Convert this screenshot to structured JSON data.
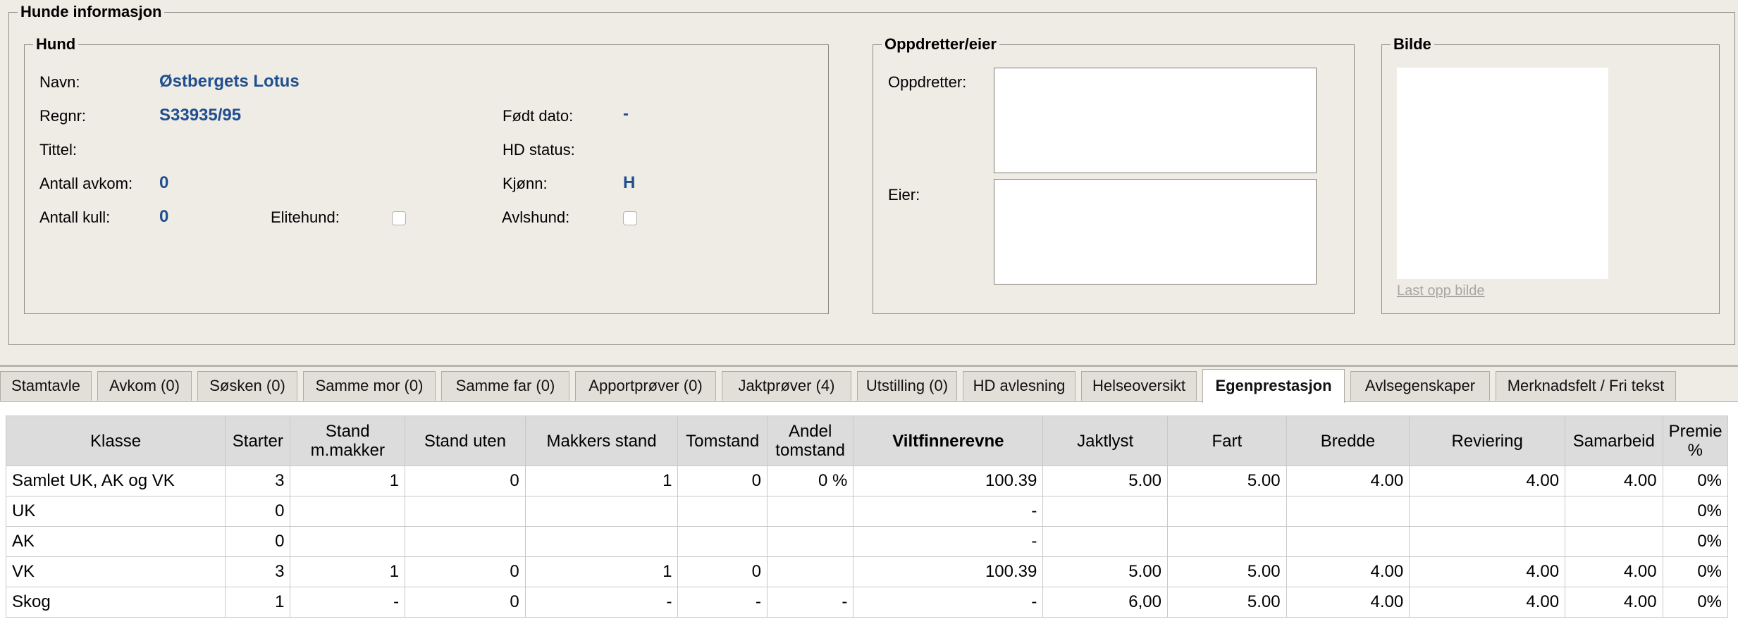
{
  "main_legend": "Hunde informasjon",
  "hund": {
    "legend": "Hund",
    "navn_label": "Navn:",
    "navn_value": "Østbergets Lotus",
    "regnr_label": "Regnr:",
    "regnr_value": "S33935/95",
    "fodt_label": "Født dato:",
    "fodt_value": "-",
    "tittel_label": "Tittel:",
    "hd_label": "HD status:",
    "avkom_label": "Antall avkom:",
    "avkom_value": "0",
    "kjonn_label": "Kjønn:",
    "kjonn_value": "H",
    "kull_label": "Antall kull:",
    "kull_value": "0",
    "elitehund_label": "Elitehund:",
    "avlshund_label": "Avlshund:"
  },
  "oppdretter": {
    "legend": "Oppdretter/eier",
    "oppdretter_label": "Oppdretter:",
    "eier_label": "Eier:"
  },
  "bilde": {
    "legend": "Bilde",
    "upload_link": "Last opp bilde"
  },
  "tabs": [
    "Stamtavle",
    "Avkom (0)",
    "Søsken (0)",
    "Samme mor (0)",
    "Samme far (0)",
    "Apportprøver (0)",
    "Jaktprøver (4)",
    "Utstilling (0)",
    "HD avlesning",
    "Helseoversikt",
    "Egenprestasjon",
    "Avlsegenskaper",
    "Merknadsfelt / Fri tekst"
  ],
  "active_tab": "Egenprestasjon",
  "table": {
    "headers": [
      "Klasse",
      "Starter",
      "Stand m.makker",
      "Stand uten",
      "Makkers stand",
      "Tomstand",
      "Andel tomstand",
      "Viltfinnerevne",
      "Jaktlyst",
      "Fart",
      "Bredde",
      "Reviering",
      "Samarbeid",
      "Premie %"
    ],
    "rows": [
      [
        "Samlet UK, AK og VK",
        "3",
        "1",
        "0",
        "1",
        "0",
        "0 %",
        "100.39",
        "5.00",
        "5.00",
        "4.00",
        "4.00",
        "4.00",
        "0%"
      ],
      [
        "UK",
        "0",
        "",
        "",
        "",
        "",
        "",
        "-",
        "",
        "",
        "",
        "",
        "",
        "0%"
      ],
      [
        "AK",
        "0",
        "",
        "",
        "",
        "",
        "",
        "-",
        "",
        "",
        "",
        "",
        "",
        "0%"
      ],
      [
        "VK",
        "3",
        "1",
        "0",
        "1",
        "0",
        "",
        "100.39",
        "5.00",
        "5.00",
        "4.00",
        "4.00",
        "4.00",
        "0%"
      ],
      [
        "Skog",
        "1",
        "-",
        "0",
        "-",
        "-",
        "-",
        "-",
        "6,00",
        "5.00",
        "4.00",
        "4.00",
        "4.00",
        "0%"
      ]
    ]
  }
}
